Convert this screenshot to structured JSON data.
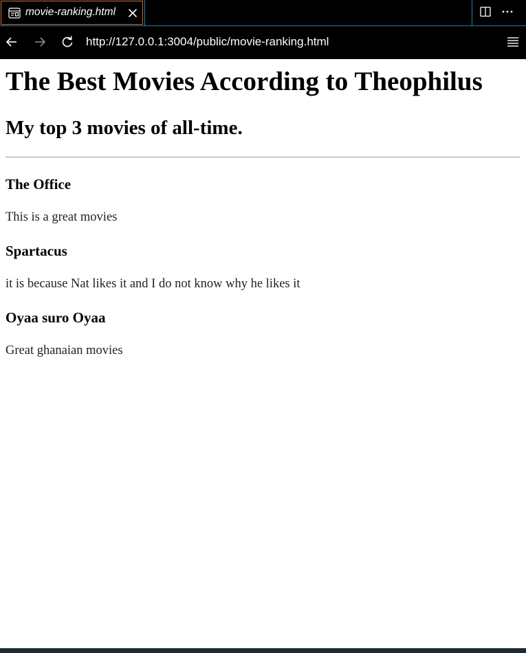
{
  "tab": {
    "title": "movie-ranking.html"
  },
  "address_bar": {
    "url": "http://127.0.0.1:3004/public/movie-ranking.html"
  },
  "page": {
    "heading": "The Best Movies According to Theophilus",
    "subheading": "My top 3 movies of all-time.",
    "movies": [
      {
        "title": "The Office",
        "description": "This is a great movies"
      },
      {
        "title": "Spartacus",
        "description": "it is because Nat likes it and I do not know why he likes it"
      },
      {
        "title": "Oyaa suro Oyaa",
        "description": "Great ghanaian movies"
      }
    ]
  },
  "icons": {
    "tab": "preview-file-icon",
    "close": "close-icon",
    "split": "split-editor-icon",
    "more": "more-actions-icon",
    "back": "arrow-left-icon",
    "forward": "arrow-right-icon",
    "reload": "reload-icon",
    "menu": "menu-icon"
  },
  "colors": {
    "chrome_bg": "#000000",
    "active_tab_border": "#c96f3a",
    "divider": "#2b79a8",
    "page_bg": "#ffffff"
  }
}
